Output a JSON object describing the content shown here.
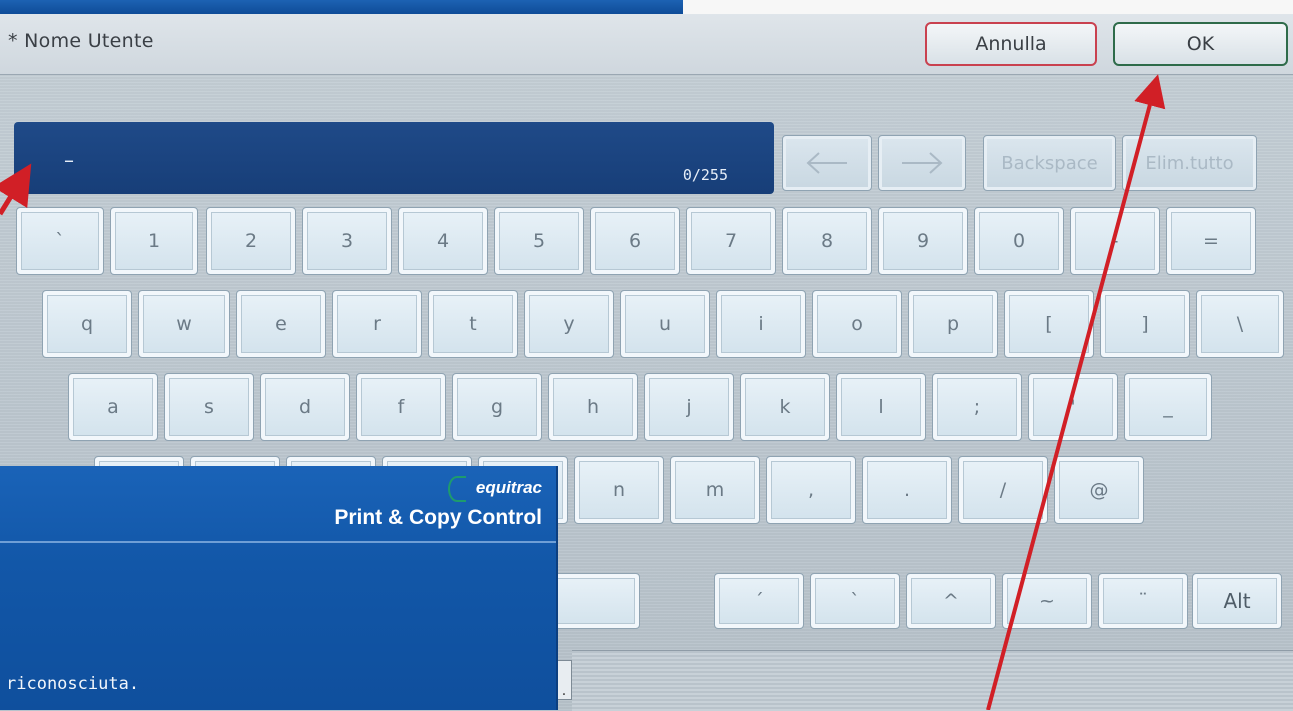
{
  "header": {
    "title": "* Nome Utente",
    "cancel_label": "Annulla",
    "ok_label": "OK"
  },
  "input": {
    "value": "–",
    "counter": "0/255"
  },
  "controls": {
    "backspace": "Backspace",
    "clear_all": "Elim.tutto",
    "left_icon": "arrow-left-icon",
    "right_icon": "arrow-right-icon"
  },
  "keyboard": {
    "row1": [
      "`",
      "1",
      "2",
      "3",
      "4",
      "5",
      "6",
      "7",
      "8",
      "9",
      "0",
      "-",
      "="
    ],
    "row2": [
      "q",
      "w",
      "e",
      "r",
      "t",
      "y",
      "u",
      "i",
      "o",
      "p",
      "[",
      "]",
      "\\"
    ],
    "row3": [
      "a",
      "s",
      "d",
      "f",
      "g",
      "h",
      "j",
      "k",
      "l",
      ";",
      "'",
      "_"
    ],
    "row4": [
      "n",
      "m",
      ",",
      ".",
      "/",
      "@"
    ],
    "accents": [
      "´",
      "`",
      "^",
      "~",
      "¨"
    ],
    "alt": "Alt"
  },
  "overlay": {
    "brand": "equitrac",
    "product": "Print & Copy Control",
    "message": "riconosciuta."
  },
  "bottom": {
    "dot": "."
  },
  "colors": {
    "annotation_arrow": "#d11f26",
    "input_bg": "#1f4a88",
    "overlay_bg": "#1257a8"
  }
}
